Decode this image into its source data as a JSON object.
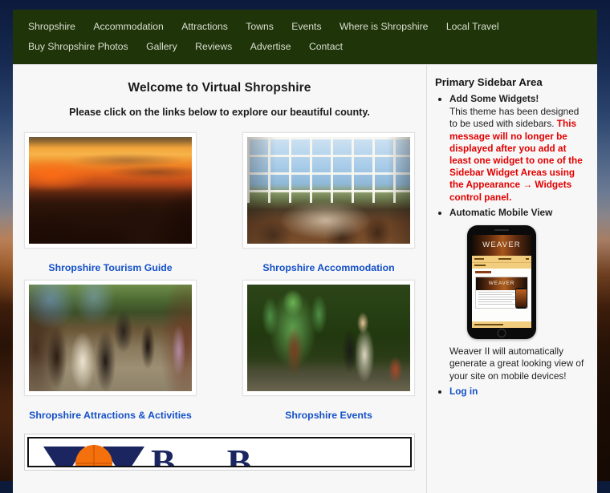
{
  "site": {
    "title": "Virtual Shropshire"
  },
  "nav": {
    "items": [
      {
        "label": "Shropshire",
        "name": "nav-shropshire"
      },
      {
        "label": "Accommodation",
        "name": "nav-accommodation"
      },
      {
        "label": "Attractions",
        "name": "nav-attractions"
      },
      {
        "label": "Towns",
        "name": "nav-towns"
      },
      {
        "label": "Events",
        "name": "nav-events"
      },
      {
        "label": "Where is Shropshire",
        "name": "nav-where-is-shropshire"
      },
      {
        "label": "Local Travel",
        "name": "nav-local-travel"
      },
      {
        "label": "Buy Shropshire Photos",
        "name": "nav-buy-shropshire-photos"
      },
      {
        "label": "Gallery",
        "name": "nav-gallery"
      },
      {
        "label": "Reviews",
        "name": "nav-reviews"
      },
      {
        "label": "Advertise",
        "name": "nav-advertise"
      },
      {
        "label": "Contact",
        "name": "nav-contact"
      }
    ]
  },
  "main": {
    "title": "Welcome to Virtual Shropshire",
    "subtitle": "Please click on the links below to explore our beautiful county.",
    "tiles": [
      {
        "caption": "Shropshire Tourism Guide",
        "image": "sunset-over-shropshire-hills-photo"
      },
      {
        "caption": "Shropshire Accommodation",
        "image": "conservatory-dining-room-photo"
      },
      {
        "caption": "Shropshire Attractions & Activities",
        "image": "victorian-street-reenactment-photo"
      },
      {
        "caption": "Shropshire Events",
        "image": "green-man-festival-photo"
      }
    ],
    "banner": {
      "name": "shropshire-tourism-logo-banner",
      "letters": [
        "B",
        "B"
      ]
    }
  },
  "sidebar": {
    "title": "Primary Sidebar Area",
    "widgets": [
      {
        "heading": "Add Some Widgets!",
        "body_plain": "This theme has been designed to be used with sidebars. ",
        "body_alert": "This message will no longer be displayed after you add at least one widget to one of the Sidebar Widget Areas using the Appearance → Widgets control panel."
      },
      {
        "heading": "Automatic Mobile View",
        "phone_brand": "WEAVER",
        "phone_card_brand": "WEAVER",
        "paragraph": "Weaver II will automatically generate a great looking view of your site on mobile devices!"
      },
      {
        "link": "Log in"
      }
    ]
  },
  "colors": {
    "nav_background": "#203409",
    "nav_text": "#d9dfd2",
    "link_blue": "#1450c8",
    "alert_red": "#e30000",
    "content_background": "#f7f7f7",
    "logo_navy": "#1b2660",
    "logo_orange": "#f4700c"
  }
}
